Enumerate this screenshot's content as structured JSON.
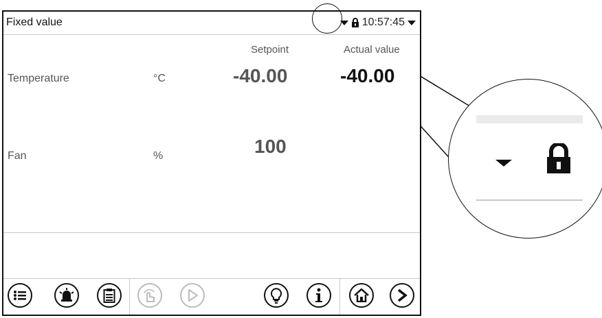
{
  "header": {
    "title": "Fixed value",
    "time": "10:57:45"
  },
  "columns": {
    "setpoint": "Setpoint",
    "actual": "Actual value"
  },
  "rows": [
    {
      "label": "Temperature",
      "unit": "°C",
      "setpoint": "-40.00",
      "actual": "-40.00"
    },
    {
      "label": "Fan",
      "unit": "%",
      "setpoint": "100",
      "actual": ""
    }
  ],
  "toolbar": {
    "icons": [
      "menu-icon",
      "alarm-icon",
      "event-list-icon",
      "manual-icon",
      "start-icon",
      "tips-icon",
      "info-icon",
      "home-icon",
      "next-icon"
    ]
  },
  "colors": {
    "text": "#222222",
    "disabled": "#bbbbbb",
    "separator": "#c8c8c8"
  }
}
